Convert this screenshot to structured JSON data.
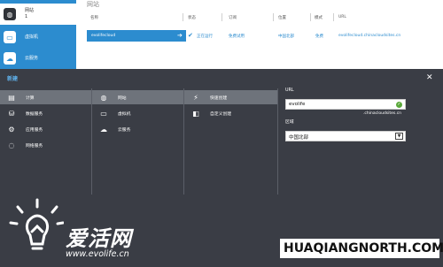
{
  "nav": {
    "items": [
      {
        "label": "网站",
        "sub": "1",
        "icon": "globe-icon"
      },
      {
        "label": "虚拟机",
        "sub": "",
        "icon": "monitor-icon"
      },
      {
        "label": "云服务",
        "sub": "",
        "icon": "cloud-icon"
      }
    ]
  },
  "page": {
    "title": "网站"
  },
  "table": {
    "headers": [
      "名称",
      "状态",
      "订阅",
      "位置",
      "模式",
      "URL"
    ],
    "row": {
      "name": "evolifecloud",
      "status": "正在运行",
      "subscription": "免费试用",
      "location": "中国北部",
      "mode": "免费",
      "url": "evolifecloud.chinacloudsites.cn"
    }
  },
  "drawer": {
    "title": "新建",
    "close_glyph": "✕",
    "categories": [
      {
        "label": "计算",
        "icon": "compute-icon"
      },
      {
        "label": "数据服务",
        "icon": "database-icon"
      },
      {
        "label": "应用服务",
        "icon": "app-services-icon"
      },
      {
        "label": "网络服务",
        "icon": "network-icon"
      }
    ],
    "services": [
      {
        "label": "网站",
        "icon": "globe-icon"
      },
      {
        "label": "虚拟机",
        "icon": "monitor-icon"
      },
      {
        "label": "云服务",
        "icon": "cloud-icon"
      }
    ],
    "actions": [
      {
        "label": "快速创建",
        "icon": "lightning-icon"
      },
      {
        "label": "自定义创建",
        "icon": "box-icon"
      }
    ],
    "form": {
      "url_label": "URL",
      "url_value": "evolife",
      "url_suffix": ".chinacloudsites.cn",
      "region_label": "区域",
      "region_value": "中国北部"
    }
  },
  "watermark": {
    "brand": "爱活网",
    "site": "www.evolife.cn",
    "corner": "HUAQIANGNORTH.COM"
  }
}
